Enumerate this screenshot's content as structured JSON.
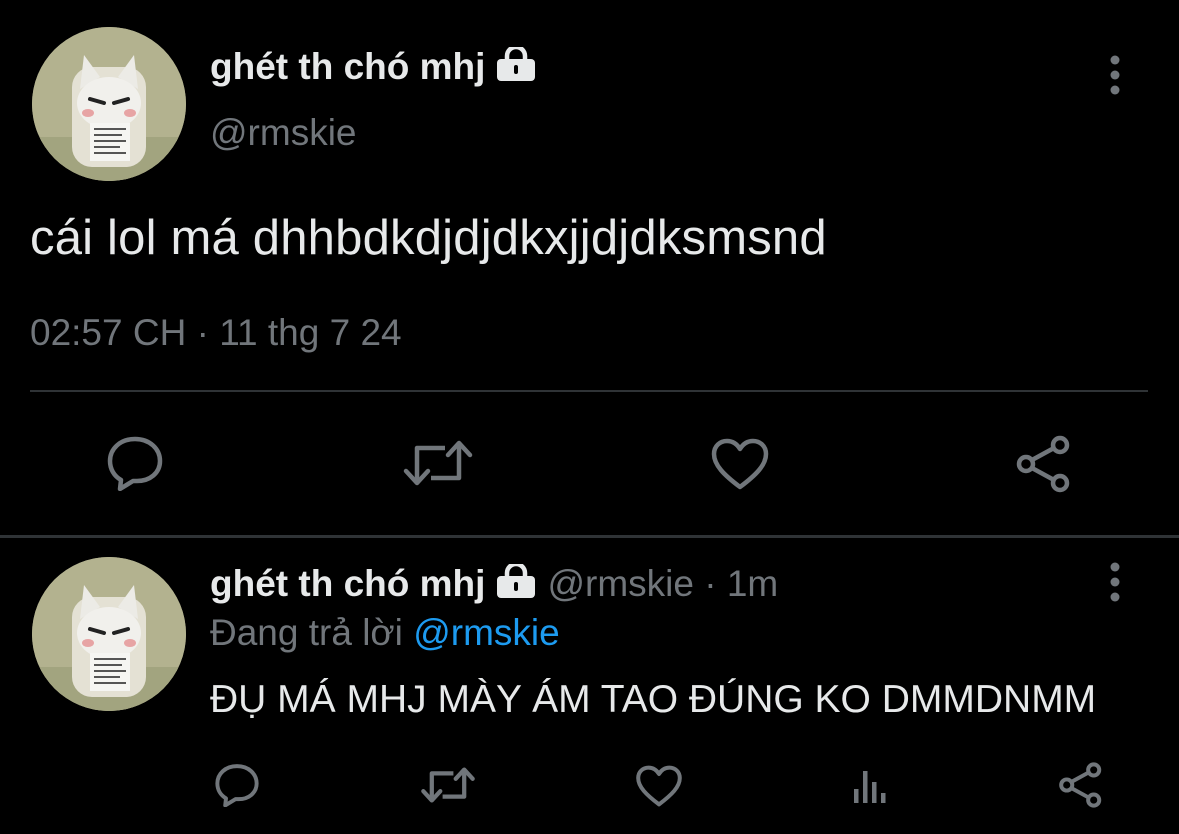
{
  "main_tweet": {
    "display_name": "ghét th chó mhj",
    "handle": "@rmskie",
    "text": "cái lol má dhhbdkdjdjdkxjjdjdksmsnd",
    "timestamp": "02:57 CH · 11 thg 7 24",
    "icons": {
      "lock": "lock-icon",
      "more": "more-vertical-icon",
      "reply": "reply-icon",
      "retweet": "retweet-icon",
      "like": "like-icon",
      "share": "share-icon"
    }
  },
  "reply_tweet": {
    "display_name": "ghét th chó mhj",
    "meta": "@rmskie · 1m",
    "replying_prefix": "Đang trả lời",
    "replying_to": "@rmskie",
    "text": "ĐỤ MÁ MHJ MÀY ÁM TAO ĐÚNG KO DMMDNMM",
    "icons": {
      "reply": "reply-icon",
      "retweet": "retweet-icon",
      "like": "like-icon",
      "views": "analytics-icon",
      "share": "share-icon"
    }
  },
  "colors": {
    "background": "#000000",
    "text_primary": "#e7e9ea",
    "text_secondary": "#71767b",
    "accent": "#1d9bf0",
    "divider": "#2f3336"
  }
}
